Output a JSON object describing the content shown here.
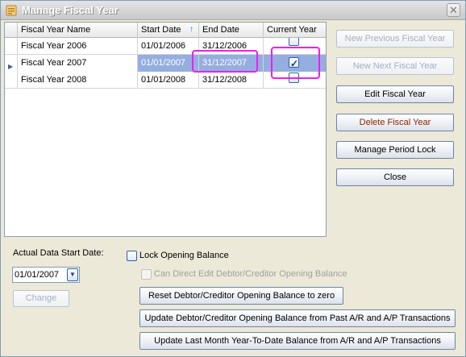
{
  "window": {
    "title": "Manage Fiscal Year"
  },
  "grid": {
    "columns": [
      "Fiscal Year Name",
      "Start Date",
      "End Date",
      "Current Year"
    ],
    "rows": [
      {
        "name": "Fiscal Year 2006",
        "start": "01/01/2006",
        "end": "31/12/2006",
        "current": false
      },
      {
        "name": "Fiscal Year 2007",
        "start": "01/01/2007",
        "end": "31/12/2007",
        "current": true
      },
      {
        "name": "Fiscal Year 2008",
        "start": "01/01/2008",
        "end": "31/12/2008",
        "current": false
      }
    ],
    "sort_indicator": "↑"
  },
  "side_buttons": {
    "new_previous": "New Previous Fiscal Year",
    "new_next": "New Next Fiscal Year",
    "edit": "Edit Fiscal Year",
    "delete": "Delete Fiscal Year",
    "manage_period_lock": "Manage Period Lock",
    "close": "Close"
  },
  "bottom": {
    "actual_start_label": "Actual Data Start Date:",
    "actual_start_value": "01/01/2007",
    "change_button": "Change",
    "lock_opening_balance": "Lock Opening Balance",
    "can_direct_edit": "Can Direct Edit Debtor/Creditor Opening Balance",
    "reset_button": "Reset Debtor/Creditor Opening Balance to zero",
    "update_opening_button": "Update Debtor/Creditor Opening Balance from Past A/R and A/P Transactions",
    "update_ytd_button": "Update Last Month Year-To-Date Balance from A/R and A/P Transactions"
  },
  "colors": {
    "selection": "#95aee0",
    "highlight": "#ee1eee",
    "title_text": "#ffffff"
  },
  "icons": {
    "title": "window-app-icon",
    "close": "close-icon",
    "dropdown": "chevron-down-icon",
    "row_pointer": "row-pointer-icon"
  }
}
